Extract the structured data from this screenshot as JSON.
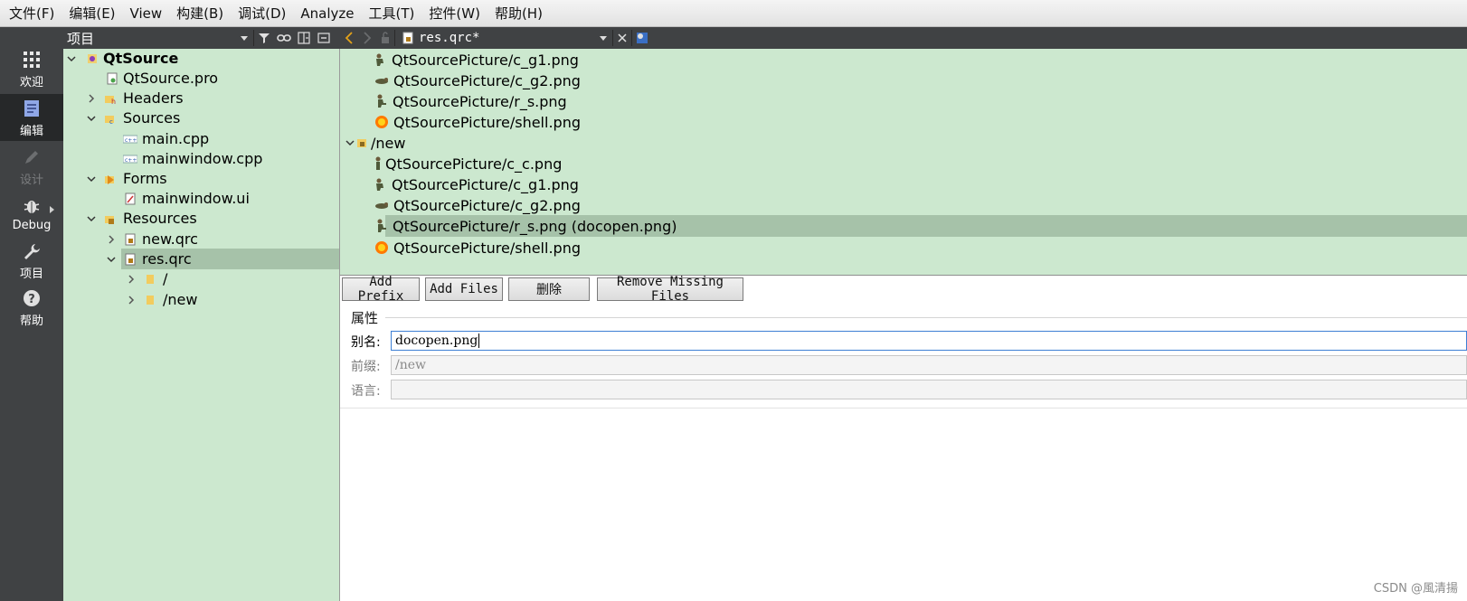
{
  "menubar": {
    "items": [
      "文件(F)",
      "编辑(E)",
      "View",
      "构建(B)",
      "调试(D)",
      "Analyze",
      "工具(T)",
      "控件(W)",
      "帮助(H)"
    ]
  },
  "modebar": {
    "modes": [
      {
        "label": "欢迎",
        "icon": "grid-icon"
      },
      {
        "label": "编辑",
        "icon": "document-icon"
      },
      {
        "label": "设计",
        "icon": "pencil-icon"
      },
      {
        "label": "Debug",
        "icon": "bug-icon"
      },
      {
        "label": "项目",
        "icon": "wrench-icon"
      },
      {
        "label": "帮助",
        "icon": "help-icon"
      }
    ],
    "active": "编辑"
  },
  "project_pane": {
    "title": "项目",
    "tree": [
      {
        "label": "QtSource",
        "level": 0,
        "expanded": true,
        "icon": "project-icon"
      },
      {
        "label": "QtSource.pro",
        "level": 1,
        "icon": "pro-file-icon"
      },
      {
        "label": "Headers",
        "level": 1,
        "expanded": false,
        "icon": "headers-folder-icon"
      },
      {
        "label": "Sources",
        "level": 1,
        "expanded": true,
        "icon": "sources-folder-icon"
      },
      {
        "label": "main.cpp",
        "level": 2,
        "icon": "cpp-file-icon"
      },
      {
        "label": "mainwindow.cpp",
        "level": 2,
        "icon": "cpp-file-icon"
      },
      {
        "label": "Forms",
        "level": 1,
        "expanded": true,
        "icon": "forms-folder-icon"
      },
      {
        "label": "mainwindow.ui",
        "level": 2,
        "icon": "ui-file-icon"
      },
      {
        "label": "Resources",
        "level": 1,
        "expanded": true,
        "icon": "resources-folder-icon"
      },
      {
        "label": "new.qrc",
        "level": 2,
        "expanded": false,
        "icon": "qrc-file-icon"
      },
      {
        "label": "res.qrc",
        "level": 2,
        "expanded": true,
        "icon": "qrc-file-icon",
        "selected": true
      },
      {
        "label": "/",
        "level": 3,
        "expanded": false,
        "icon": "folder-icon"
      },
      {
        "label": "/new",
        "level": 3,
        "expanded": false,
        "icon": "folder-icon"
      }
    ]
  },
  "editor": {
    "document": "res.qrc*",
    "resource_tree": [
      {
        "label": "QtSourcePicture/c_g1.png",
        "icon": "soldier-crouch-icon"
      },
      {
        "label": "QtSourcePicture/c_g2.png",
        "icon": "soldier-prone-icon"
      },
      {
        "label": "QtSourcePicture/r_s.png",
        "icon": "soldier-run-icon"
      },
      {
        "label": "QtSourcePicture/shell.png",
        "icon": "shell-icon"
      },
      {
        "label": "/new",
        "icon": "folder-icon",
        "prefix": true
      },
      {
        "label": "QtSourcePicture/c_c.png",
        "icon": "soldier-stand-icon"
      },
      {
        "label": "QtSourcePicture/c_g1.png",
        "icon": "soldier-crouch-icon"
      },
      {
        "label": "QtSourcePicture/c_g2.png",
        "icon": "soldier-prone-icon"
      },
      {
        "label": "QtSourcePicture/r_s.png (docopen.png)",
        "icon": "soldier-run-icon",
        "selected": true
      },
      {
        "label": "QtSourcePicture/shell.png",
        "icon": "shell-icon"
      }
    ],
    "buttons": {
      "add_prefix": "Add Prefix",
      "add_files": "Add Files",
      "delete": "删除",
      "remove_missing": "Remove Missing Files"
    },
    "properties": {
      "title": "属性",
      "alias_label": "别名:",
      "alias_value": "docopen.png",
      "prefix_label": "前缀:",
      "prefix_value": "/new",
      "language_label": "语言:",
      "language_value": ""
    }
  },
  "watermark": "CSDN @風清揚"
}
